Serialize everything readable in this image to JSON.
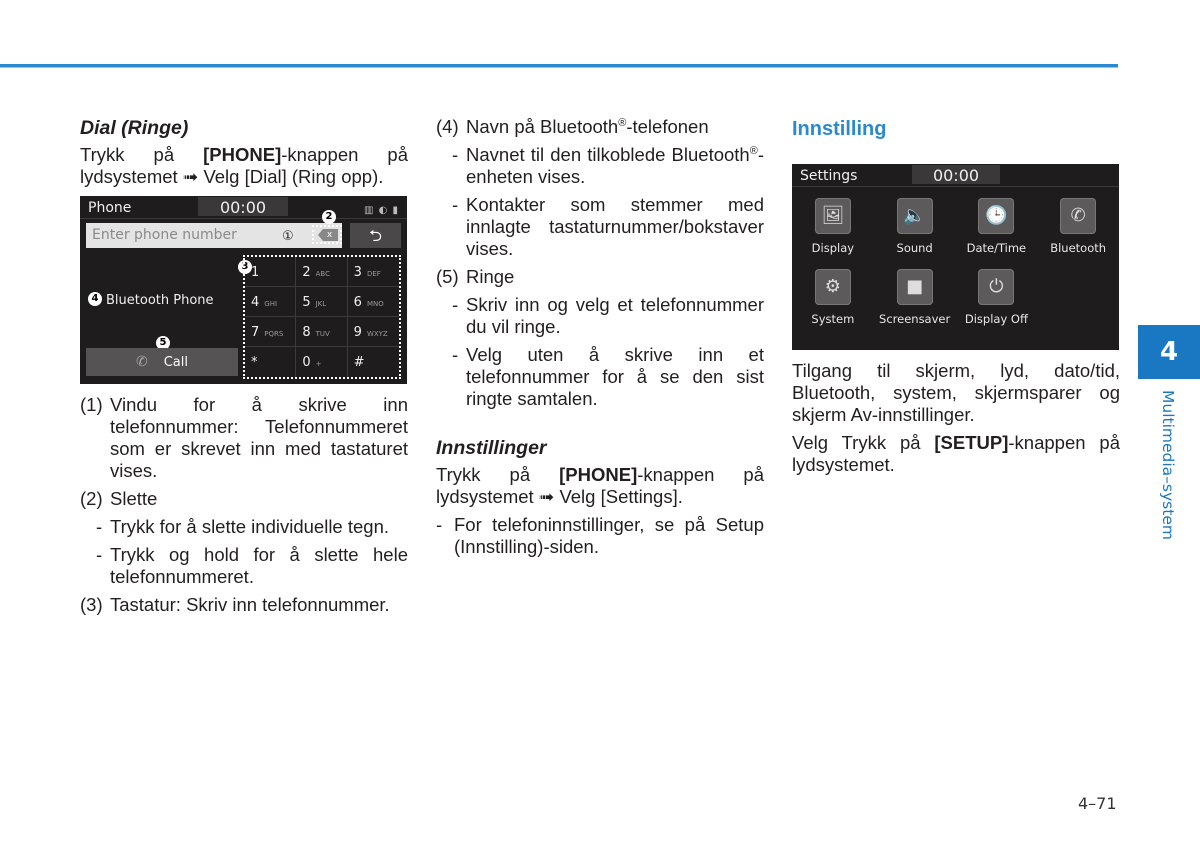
{
  "col1": {
    "heading": "Dial (Ringe)",
    "intro_pre": "Trykk på ",
    "intro_bold": "[PHONE]",
    "intro_post": "-knappen på lydsystemet ➟ Velg [Dial] (Ring opp).",
    "phone_screen": {
      "title": "Phone",
      "clock": "00:00",
      "status_icons": "▥ ◐ ▮",
      "input_placeholder": "Enter phone number",
      "delete_label": "x",
      "back_icon": "⮌",
      "bluetooth_name": "Bluetooth Phone",
      "call_label": "Call",
      "callouts": [
        "①",
        "2",
        "3",
        "4",
        "5"
      ],
      "keys": [
        {
          "d": "1",
          "l": ""
        },
        {
          "d": "2",
          "l": "ABC"
        },
        {
          "d": "3",
          "l": "DEF"
        },
        {
          "d": "4",
          "l": "GHI"
        },
        {
          "d": "5",
          "l": "JKL"
        },
        {
          "d": "6",
          "l": "MNO"
        },
        {
          "d": "7",
          "l": "PQRS"
        },
        {
          "d": "8",
          "l": "TUV"
        },
        {
          "d": "9",
          "l": "WXYZ"
        },
        {
          "d": "*",
          "l": ""
        },
        {
          "d": "0",
          "l": "+"
        },
        {
          "d": "#",
          "l": ""
        }
      ]
    },
    "items": [
      {
        "num": "(1)",
        "text": "Vindu for å skrive inn telefonnummer: Telefonnummeret som er skrevet inn med tastaturet vises."
      },
      {
        "num": "(2)",
        "text": "Slette"
      },
      {
        "dash": "-",
        "text": "Trykk for å slette individuelle tegn."
      },
      {
        "dash": "-",
        "text": "Trykk og hold for å slette hele telefonnummeret."
      },
      {
        "num": "(3)",
        "text": "Tastatur: Skriv inn telefonnummer."
      }
    ]
  },
  "col2": {
    "item4_pre": "Navn på Bluetooth",
    "item4_sup": "®",
    "item4_post": "-telefonen",
    "item4_num": "(4)",
    "d1_pre": "Navnet til den tilkoblede Bluetooth",
    "d1_sup": "®",
    "d1_post": "-enheten vises.",
    "d2": "Kontakter som stemmer med innlagte tastaturnummer/bokstaver vises.",
    "item5_num": "(5)",
    "item5": "Ringe",
    "d3": "Skriv inn og velg et telefonnummer du vil ringe.",
    "d4": "Velg uten å skrive inn et telefonnummer for å se den sist ringte samtalen.",
    "dash": "-",
    "heading": "Innstillinger",
    "intro_pre": "Trykk på ",
    "intro_bold": "[PHONE]",
    "intro_post": "-knappen på lydsystemet ➟ Velg [Settings].",
    "d5": "For telefoninnstillinger, se på Setup (Innstilling)-siden."
  },
  "col3": {
    "heading": "Innstilling",
    "settings_screen": {
      "title": "Settings",
      "clock": "00:00",
      "items": [
        {
          "label": "Display",
          "icon": "🖼"
        },
        {
          "label": "Sound",
          "icon": "🔈"
        },
        {
          "label": "Date/Time",
          "icon": "🕒"
        },
        {
          "label": "Bluetooth",
          "icon": "✆"
        },
        {
          "label": "System",
          "icon": "⚙"
        },
        {
          "label": "Screensaver",
          "icon": "■"
        },
        {
          "label": "Display Off",
          "icon": "⏻"
        }
      ]
    },
    "p1": "Tilgang til skjerm, lyd, dato/tid, Bluetooth, system, skjermsparer og skjerm Av-innstillinger.",
    "p2_pre": "Velg Trykk på ",
    "p2_bold": "[SETUP]",
    "p2_post": "-knappen på lydsystemet."
  },
  "side_tab": {
    "number": "4",
    "label": "Multimedia–system"
  },
  "page_number": "4–71",
  "colors": {
    "accent": "#2a8ad0",
    "tab": "#1a78c2",
    "screen_bg": "#1e1c1c"
  }
}
